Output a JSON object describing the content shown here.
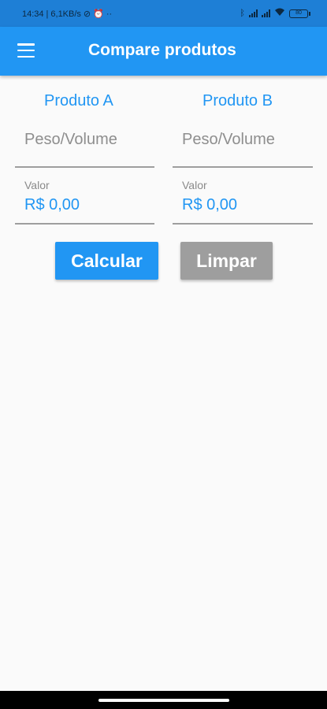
{
  "status_bar": {
    "time": "14:34",
    "network_speed": "6,1KB/s",
    "dots": "··",
    "battery": "80"
  },
  "app_bar": {
    "title": "Compare produtos",
    "menu_icon": "hamburger-menu-icon"
  },
  "product_a": {
    "title": "Produto A",
    "weight_placeholder": "Peso/Volume",
    "value_label": "Valor",
    "value": "R$ 0,00"
  },
  "product_b": {
    "title": "Produto B",
    "weight_placeholder": "Peso/Volume",
    "value_label": "Valor",
    "value": "R$ 0,00"
  },
  "actions": {
    "calculate_label": "Calcular",
    "clear_label": "Limpar"
  },
  "colors": {
    "primary": "#2196f3",
    "status_bar": "#1e7fd6",
    "clear_button": "#9e9e9e"
  }
}
